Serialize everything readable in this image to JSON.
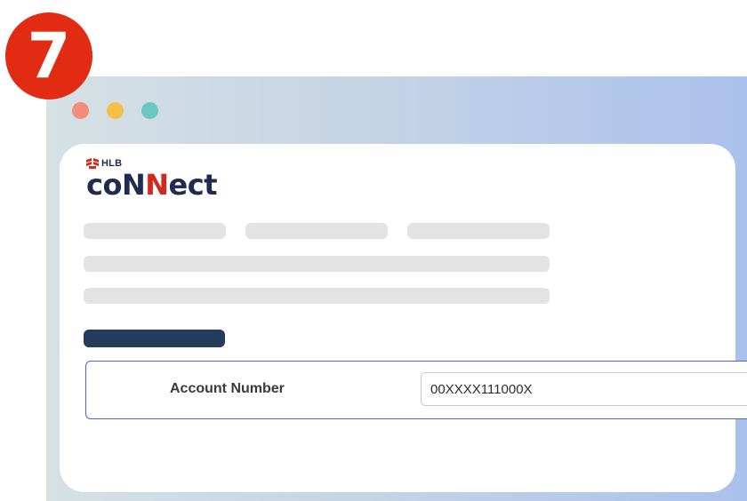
{
  "step": {
    "number": "7"
  },
  "colors": {
    "badge": "#e12b12",
    "brand_navy": "#1f2c4f",
    "brand_red": "#d5281c",
    "field_border": "#4e65c8"
  },
  "browser": {
    "window_controls": [
      "close-dot",
      "minimize-dot",
      "maximize-dot"
    ]
  },
  "logo": {
    "bank_short": "HLB",
    "word_part1": "co",
    "word_part2": "N",
    "word_part3": "N",
    "word_part4": "ect",
    "mark_icon": "hlb-mark-icon"
  },
  "form": {
    "account_number_label": "Account Number",
    "account_number_value": "00XXXX111000X"
  }
}
